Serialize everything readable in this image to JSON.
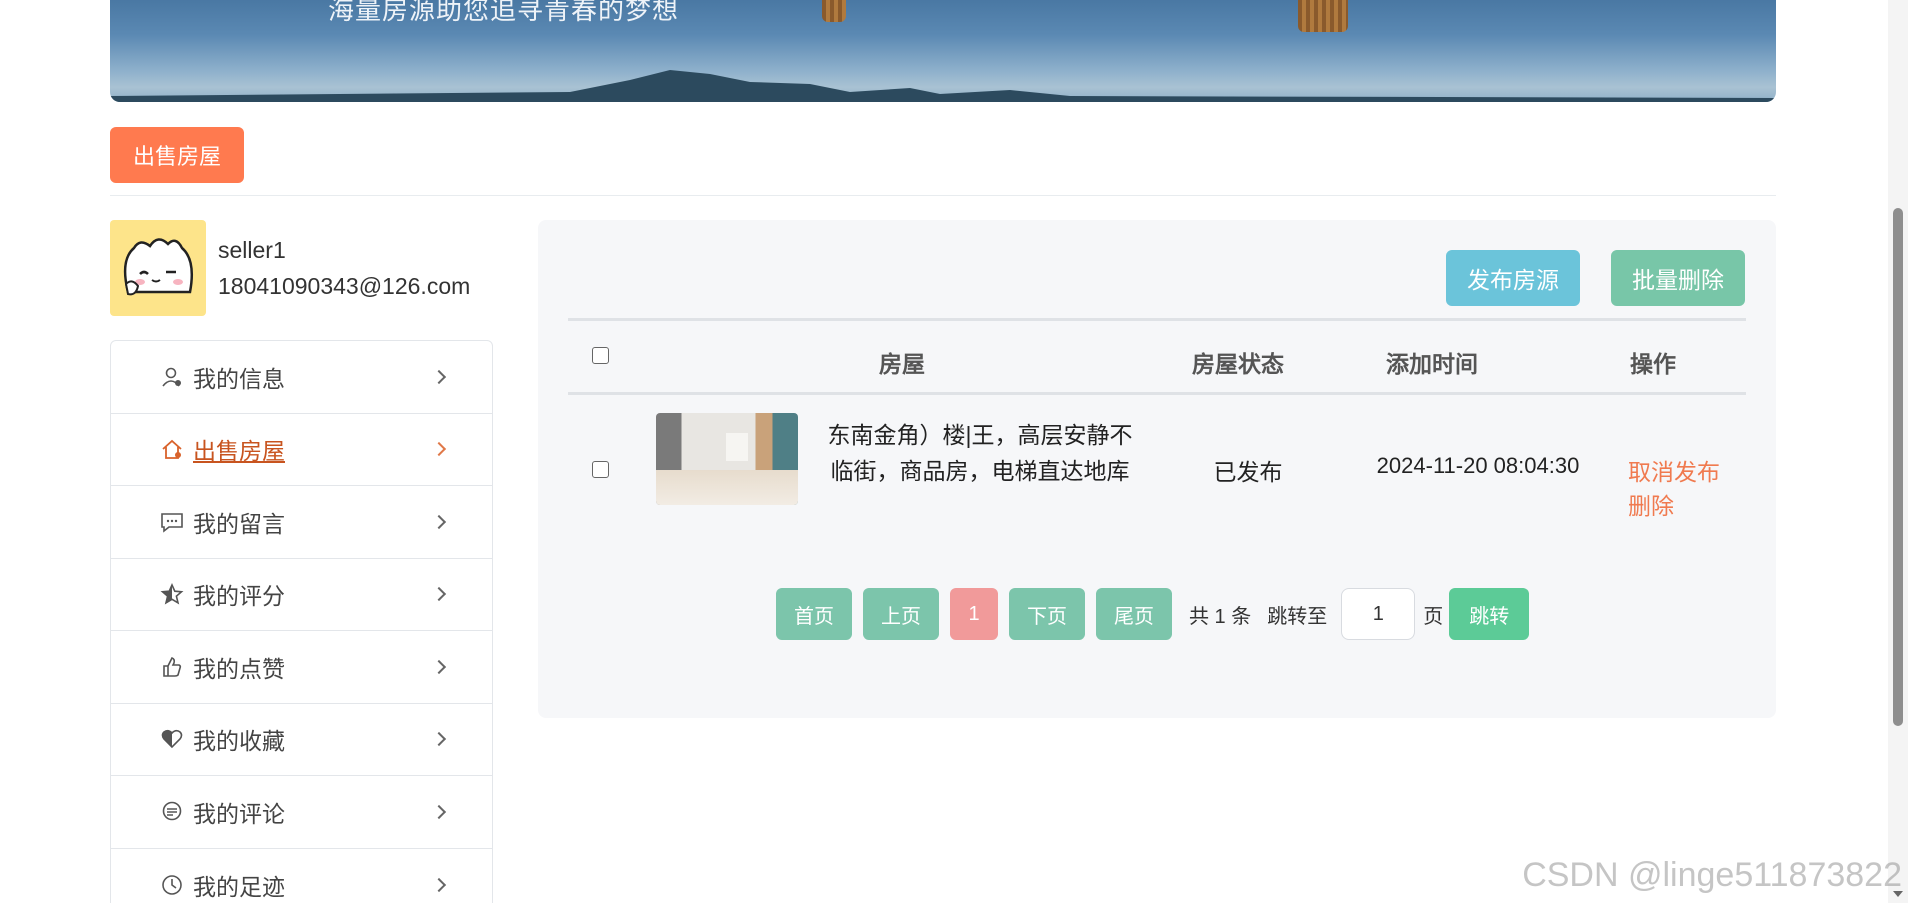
{
  "banner": {
    "slogan": "海量房源助您追寻青春的梦想"
  },
  "top_tab": {
    "label": "出售房屋"
  },
  "profile": {
    "username": "seller1",
    "email": "18041090343@126.com"
  },
  "sidebar": {
    "items": [
      {
        "label": "我的信息",
        "icon": "user-icon"
      },
      {
        "label": "出售房屋",
        "icon": "house-icon",
        "active": true
      },
      {
        "label": "我的留言",
        "icon": "message-icon"
      },
      {
        "label": "我的评分",
        "icon": "star-icon"
      },
      {
        "label": "我的点赞",
        "icon": "thumbs-up-icon"
      },
      {
        "label": "我的收藏",
        "icon": "heart-icon"
      },
      {
        "label": "我的评论",
        "icon": "comment-icon"
      },
      {
        "label": "我的足迹",
        "icon": "clock-icon"
      }
    ]
  },
  "toolbar": {
    "publish_label": "发布房源",
    "batch_delete_label": "批量删除"
  },
  "table": {
    "headers": {
      "house": "房屋",
      "status": "房屋状态",
      "added": "添加时间",
      "ops": "操作"
    },
    "rows": [
      {
        "title": "东南金角）楼|王，高层安静不临街，商品房，电梯直达地库",
        "status": "已发布",
        "added": "2024-11-20 08:04:30",
        "op_unpublish": "取消发布",
        "op_delete": "删除"
      }
    ]
  },
  "pager": {
    "first": "首页",
    "prev": "上页",
    "current": "1",
    "next": "下页",
    "last": "尾页",
    "total": "共 1 条",
    "jump_to": "跳转至",
    "page_value": "1",
    "page_unit": "页",
    "go": "跳转"
  },
  "watermark": "CSDN @linge511873822",
  "colors": {
    "accent": "#ff7a4f",
    "publish": "#6bc4da",
    "batch_delete": "#78c6a8",
    "pager": "#7cc5ab",
    "pager_current": "#f19a9a",
    "go": "#5ccb97"
  }
}
